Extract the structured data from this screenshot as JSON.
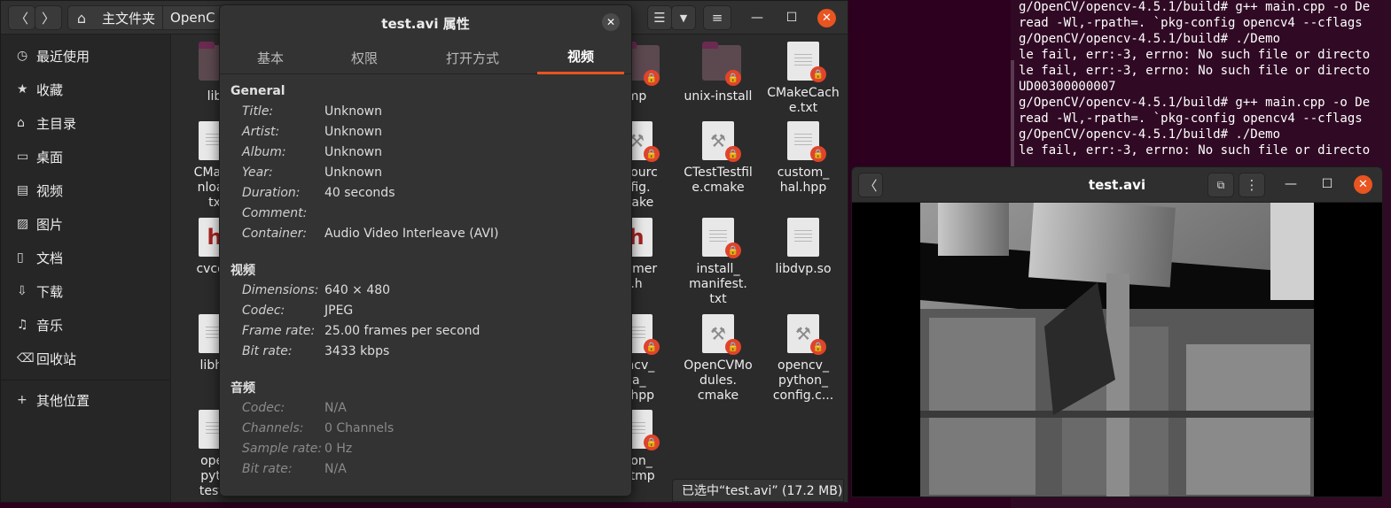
{
  "terminal": {
    "lines": [
      "g/OpenCV/opencv-4.5.1/build# g++ main.cpp -o De",
      "read -Wl,-rpath=. `pkg-config opencv4 --cflags",
      "g/OpenCV/opencv-4.5.1/build# ./Demo",
      "le fail, err:-3, errno: No such file or directo",
      "le fail, err:-3, errno: No such file or directo",
      "UD00300000007",
      "g/OpenCV/opencv-4.5.1/build# g++ main.cpp -o De",
      "read -Wl,-rpath=. `pkg-config opencv4 --cflags",
      "g/OpenCV/opencv-4.5.1/build# ./Demo",
      "le fail, err:-3, errno: No such file or directo"
    ]
  },
  "file_manager": {
    "nav": {
      "back_icon": "chevron-left-icon",
      "forward_icon": "chevron-right-icon"
    },
    "path": {
      "home_label": "主文件夹",
      "next_segment": "OpenC"
    },
    "sidebar": [
      {
        "icon": "clock-icon",
        "glyph": "◷",
        "label": "最近使用"
      },
      {
        "icon": "star-icon",
        "glyph": "★",
        "label": "收藏"
      },
      {
        "icon": "home-icon",
        "glyph": "⌂",
        "label": "主目录"
      },
      {
        "icon": "desktop-icon",
        "glyph": "▭",
        "label": "桌面"
      },
      {
        "icon": "video-icon",
        "glyph": "▤",
        "label": "视频"
      },
      {
        "icon": "picture-icon",
        "glyph": "▨",
        "label": "图片"
      },
      {
        "icon": "document-icon",
        "glyph": "▯",
        "label": "文档"
      },
      {
        "icon": "download-icon",
        "glyph": "⇩",
        "label": "下载"
      },
      {
        "icon": "music-icon",
        "glyph": "♫",
        "label": "音乐"
      },
      {
        "icon": "trash-icon",
        "glyph": "⌫",
        "label": "回收站"
      },
      {
        "icon": "plus-icon",
        "glyph": "+",
        "label": "其他位置"
      }
    ],
    "files": {
      "f1": "lib",
      "f2": "CMake\nnload\ntx",
      "f3": "cvcon",
      "f4": "libhz",
      "f5": "oper\npyth\ntests",
      "g1": "mp",
      "g2": "kSourc\nnfig.\nmake",
      "g3": "Camer\n.h",
      "g4": "encv_\nta_\ng.hpp",
      "g5": "sion_\ng.tmp",
      "h1": "unix-install",
      "h2": "CTestTestfil\ne.cmake",
      "h3": "install_\nmanifest.\ntxt",
      "h4": "OpenCVMo\ndules.\ncmake",
      "i1": "CMakeCach\ne.txt",
      "i2": "custom_\nhal.hpp",
      "i3": "libdvp.so",
      "i4": "opencv_\npython_\nconfig.c..."
    },
    "status": "已选中“test.avi” (17.2 MB)"
  },
  "dialog": {
    "title": "test.avi 属性",
    "tabs": [
      "基本",
      "权限",
      "打开方式",
      "视频"
    ],
    "active_tab": "视频",
    "general": {
      "heading": "General",
      "rows": [
        {
          "key": "Title:",
          "value": "Unknown"
        },
        {
          "key": "Artist:",
          "value": "Unknown"
        },
        {
          "key": "Album:",
          "value": "Unknown"
        },
        {
          "key": "Year:",
          "value": "Unknown"
        },
        {
          "key": "Duration:",
          "value": "40 seconds"
        },
        {
          "key": "Comment:",
          "value": ""
        },
        {
          "key": "Container:",
          "value": "Audio Video Interleave (AVI)"
        }
      ]
    },
    "video": {
      "heading": "视频",
      "rows": [
        {
          "key": "Dimensions:",
          "value": "640 × 480"
        },
        {
          "key": "Codec:",
          "value": "JPEG"
        },
        {
          "key": "Frame rate:",
          "value": "25.00 frames per second"
        },
        {
          "key": "Bit rate:",
          "value": "3433 kbps"
        }
      ]
    },
    "audio": {
      "heading": "音频",
      "rows": [
        {
          "key": "Codec:",
          "value": "N/A"
        },
        {
          "key": "Channels:",
          "value": "0 Channels"
        },
        {
          "key": "Sample rate:",
          "value": "0 Hz"
        },
        {
          "key": "Bit rate:",
          "value": "N/A"
        }
      ]
    }
  },
  "player": {
    "title": "test.avi",
    "back_icon": "chevron-left-icon",
    "pip_icon": "picture-in-picture-icon",
    "menu_icon": "kebab-menu-icon"
  },
  "colors": {
    "accent": "#e95420",
    "terminal_bg": "#300a24",
    "dialog_bg": "#333333"
  }
}
